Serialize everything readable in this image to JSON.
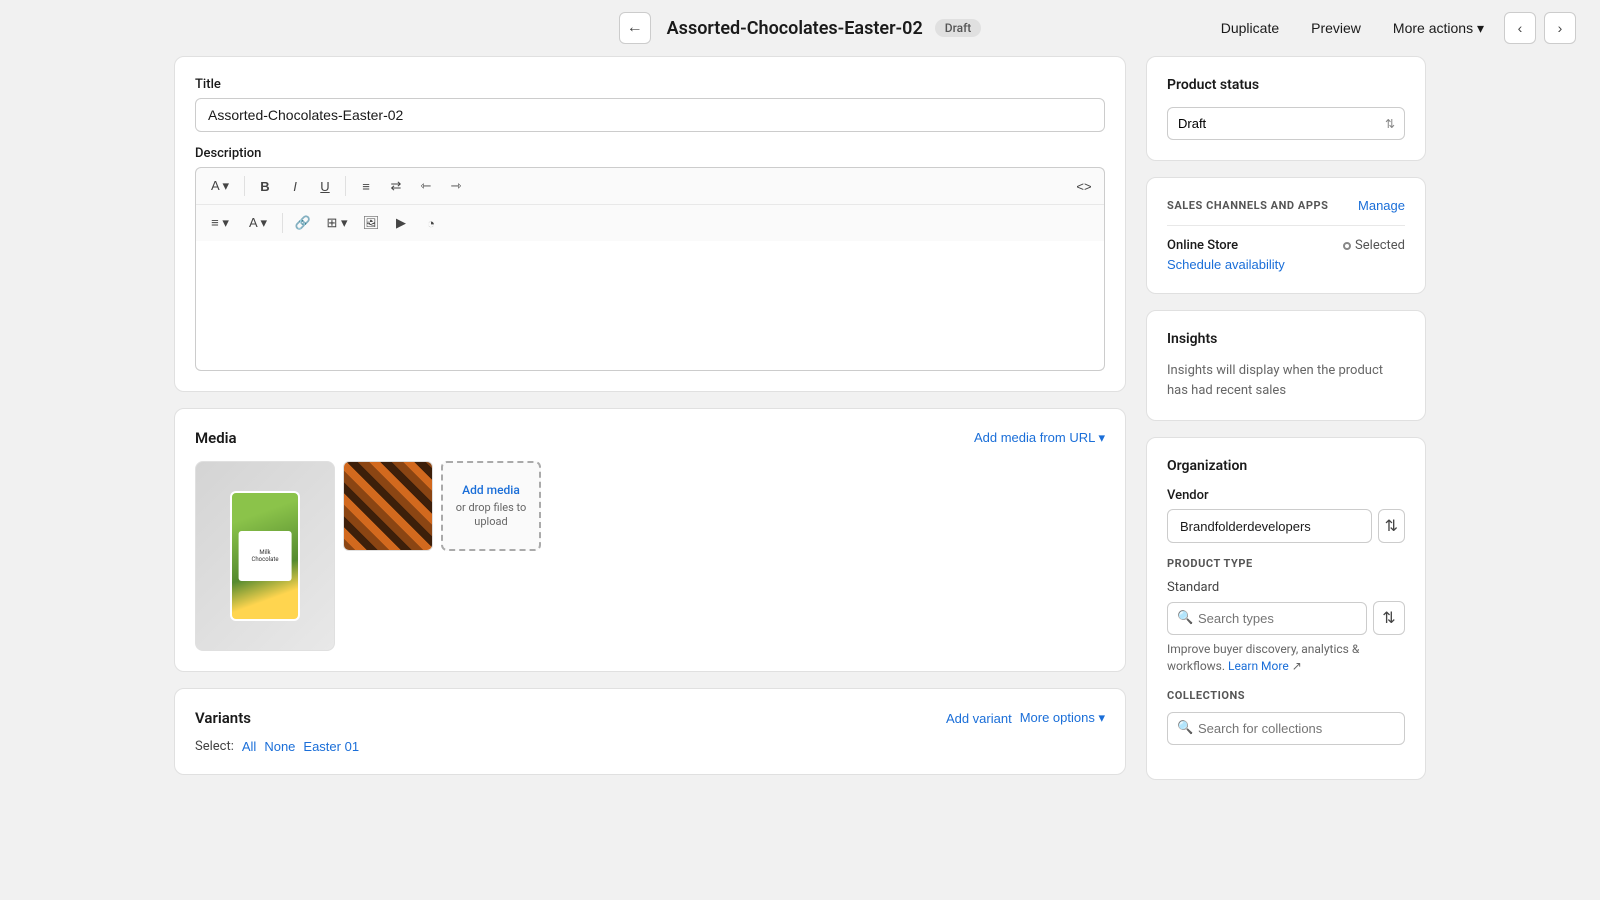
{
  "topbar": {
    "title": "Assorted-Chocolates-Easter-02",
    "badge": "Draft",
    "actions": {
      "duplicate": "Duplicate",
      "preview": "Preview",
      "more_actions": "More actions"
    }
  },
  "title_section": {
    "label": "Title",
    "value": "Assorted-Chocolates-Easter-02"
  },
  "description_section": {
    "label": "Description"
  },
  "media_section": {
    "title": "Media",
    "add_url_label": "Add media from URL ▾",
    "upload_link": "Add media",
    "upload_text": "or drop files to upload"
  },
  "variants_section": {
    "title": "Variants",
    "add_variant": "Add variant",
    "more_options": "More options ▾",
    "select_label": "Select:",
    "select_all": "All",
    "select_none": "None",
    "select_easter": "Easter 01"
  },
  "product_status": {
    "title": "Product status",
    "value": "Draft"
  },
  "sales_channels": {
    "title": "SALES CHANNELS AND APPS",
    "manage": "Manage",
    "channel_name": "Online Store",
    "channel_status": "Selected",
    "schedule_link": "Schedule availability"
  },
  "insights": {
    "title": "Insights",
    "text": "Insights will display when the product has had recent sales"
  },
  "organization": {
    "title": "Organization",
    "vendor_label": "Vendor",
    "vendor_value": "Brandfolderdevelopers",
    "product_type_label": "PRODUCT TYPE",
    "standard_label": "Standard",
    "search_types_placeholder": "Search types",
    "product_type_hint": "Improve buyer discovery, analytics & workflows.",
    "learn_more": "Learn More",
    "collections_title": "COLLECTIONS",
    "search_collections_placeholder": "Search for collections"
  },
  "toolbar": {
    "row1": [
      "A▾",
      "B",
      "I",
      "U",
      "≡",
      "☰",
      "⊴",
      "⊵",
      "<>"
    ],
    "row2": [
      "≡▾",
      "A▾",
      "🔗",
      "⊞▾",
      "🖼",
      "▶",
      "⊙"
    ]
  }
}
